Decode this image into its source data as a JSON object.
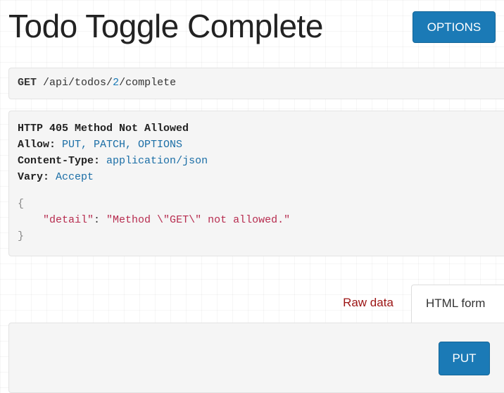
{
  "page": {
    "title": "Todo Toggle Complete"
  },
  "toolbar": {
    "options_label": "OPTIONS"
  },
  "request": {
    "method": "GET",
    "path_prefix": "/api/todos/",
    "path_id": "2",
    "path_suffix": "/complete"
  },
  "response": {
    "status_line": "HTTP 405 Method Not Allowed",
    "headers": [
      {
        "key": "Allow:",
        "value": "PUT, PATCH, OPTIONS"
      },
      {
        "key": "Content-Type:",
        "value": "application/json"
      },
      {
        "key": "Vary:",
        "value": "Accept"
      }
    ],
    "body": {
      "open_brace": "{",
      "indent": "    ",
      "key": "\"detail\"",
      "separator": ": ",
      "value": "\"Method \\\"GET\\\" not allowed.\"",
      "close_brace": "}"
    }
  },
  "tabs": {
    "raw_label": "Raw data",
    "html_label": "HTML form"
  },
  "form": {
    "submit_label": "PUT"
  },
  "colors": {
    "accent": "#1b7ab6",
    "raw_tab": "#9c1414",
    "json_string": "#b72c4f"
  }
}
